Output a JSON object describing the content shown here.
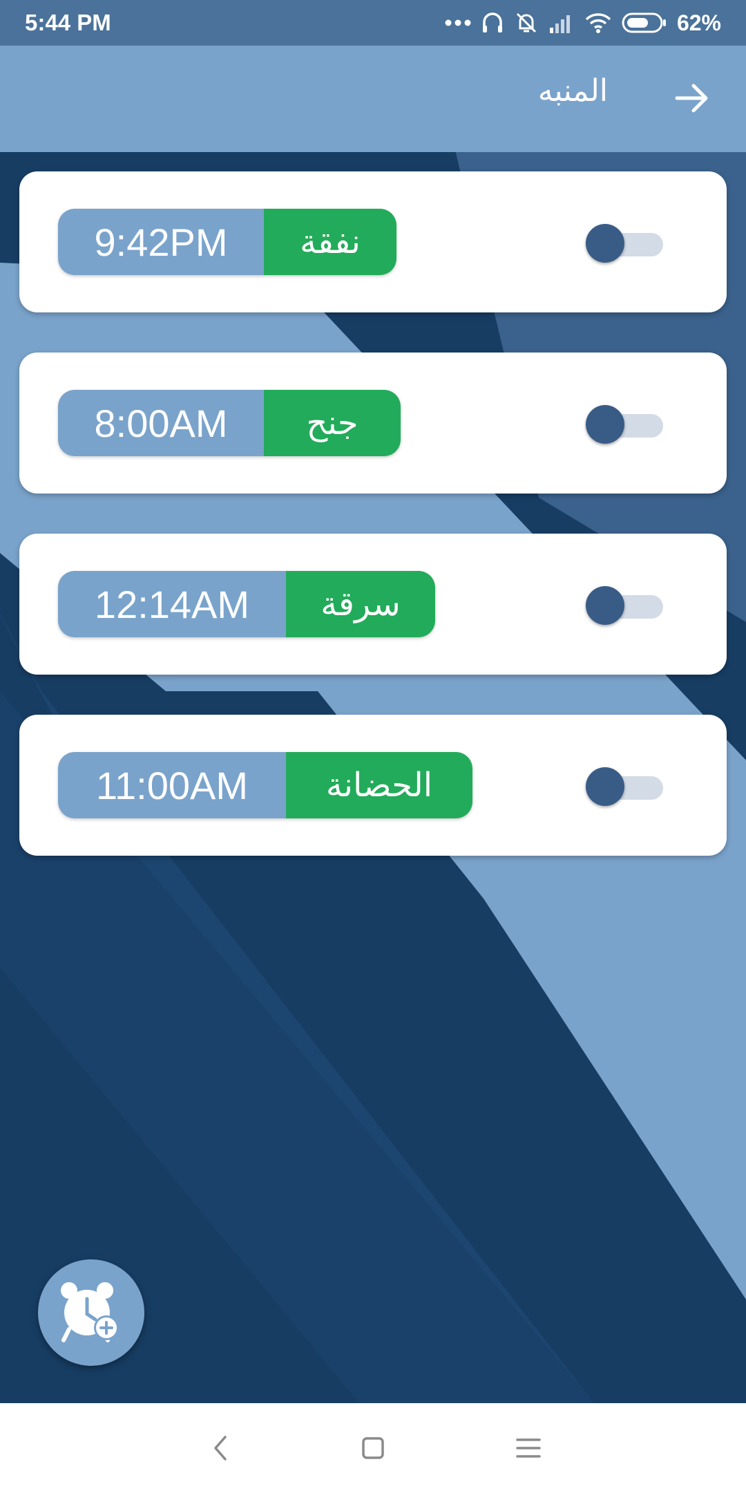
{
  "status_bar": {
    "time": "5:44 PM",
    "battery": "62%",
    "icons": [
      "more-dots-icon",
      "headset-icon",
      "mute-icon",
      "signal-icon",
      "wifi-icon",
      "battery-icon"
    ]
  },
  "app_bar": {
    "title": "المنبه",
    "back_icon": "arrow-right-icon"
  },
  "alarms": [
    {
      "time": "9:42PM",
      "label": "نفقة",
      "enabled": false
    },
    {
      "time": "8:00AM",
      "label": "جنح",
      "enabled": false
    },
    {
      "time": "12:14AM",
      "label": "سرقة",
      "enabled": false
    },
    {
      "time": "11:00AM",
      "label": "الحضانة",
      "enabled": false
    }
  ],
  "fab": {
    "icon": "add-alarm-icon"
  },
  "nav_bar": {
    "icons": [
      "back-nav-icon",
      "home-nav-icon",
      "menu-nav-icon"
    ]
  },
  "colors": {
    "status_bar": "#4a729a",
    "app_bar": "#7aa3cb",
    "label_green": "#22ab5a",
    "time_blue": "#7aa3cb",
    "toggle_knob": "#395c86",
    "background_dark": "#173d63"
  }
}
